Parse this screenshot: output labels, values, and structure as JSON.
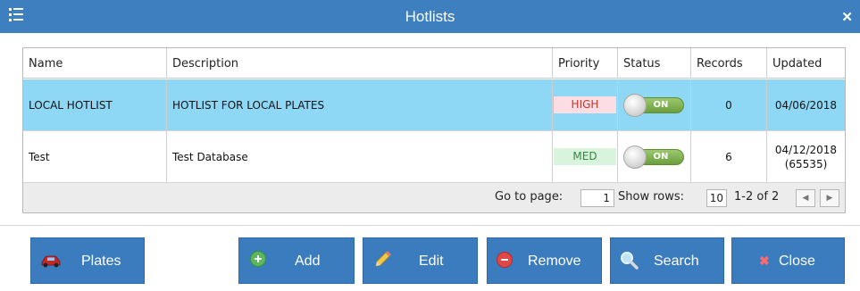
{
  "window": {
    "title": "Hotlists"
  },
  "grid": {
    "columns": [
      "Name",
      "Description",
      "Priority",
      "Status",
      "Records",
      "Updated"
    ],
    "rows": [
      {
        "name": "LOCAL HOTLIST",
        "description": "HOTLIST FOR LOCAL PLATES",
        "priority": "HIGH",
        "status": "ON",
        "records": "0",
        "updated_line1": "04/06/2018",
        "updated_line2": ""
      },
      {
        "name": "Test",
        "description": "Test Database",
        "priority": "MED",
        "status": "ON",
        "records": "6",
        "updated_line1": "04/12/2018",
        "updated_line2": "(65535)"
      }
    ],
    "pager": {
      "goto_label": "Go to page:",
      "page_value": "1",
      "show_rows_label": "Show rows:",
      "rows_value": "10",
      "range_text": "1-2 of 2"
    }
  },
  "buttons": {
    "plates": "Plates",
    "add": "Add",
    "edit": "Edit",
    "remove": "Remove",
    "search": "Search",
    "close": "Close"
  },
  "colors": {
    "accent": "#3d7fbf",
    "selected_row": "#8ed8f6",
    "priority_high": "#fbdde3",
    "priority_med": "#d9f4dc"
  },
  "icons": {
    "menu": "list-menu-icon",
    "close": "close-icon",
    "plates": "car-icon",
    "add": "plus-circle-icon",
    "edit": "pencil-icon",
    "remove": "minus-circle-icon",
    "search": "magnifier-icon",
    "close_button": "x-icon"
  }
}
